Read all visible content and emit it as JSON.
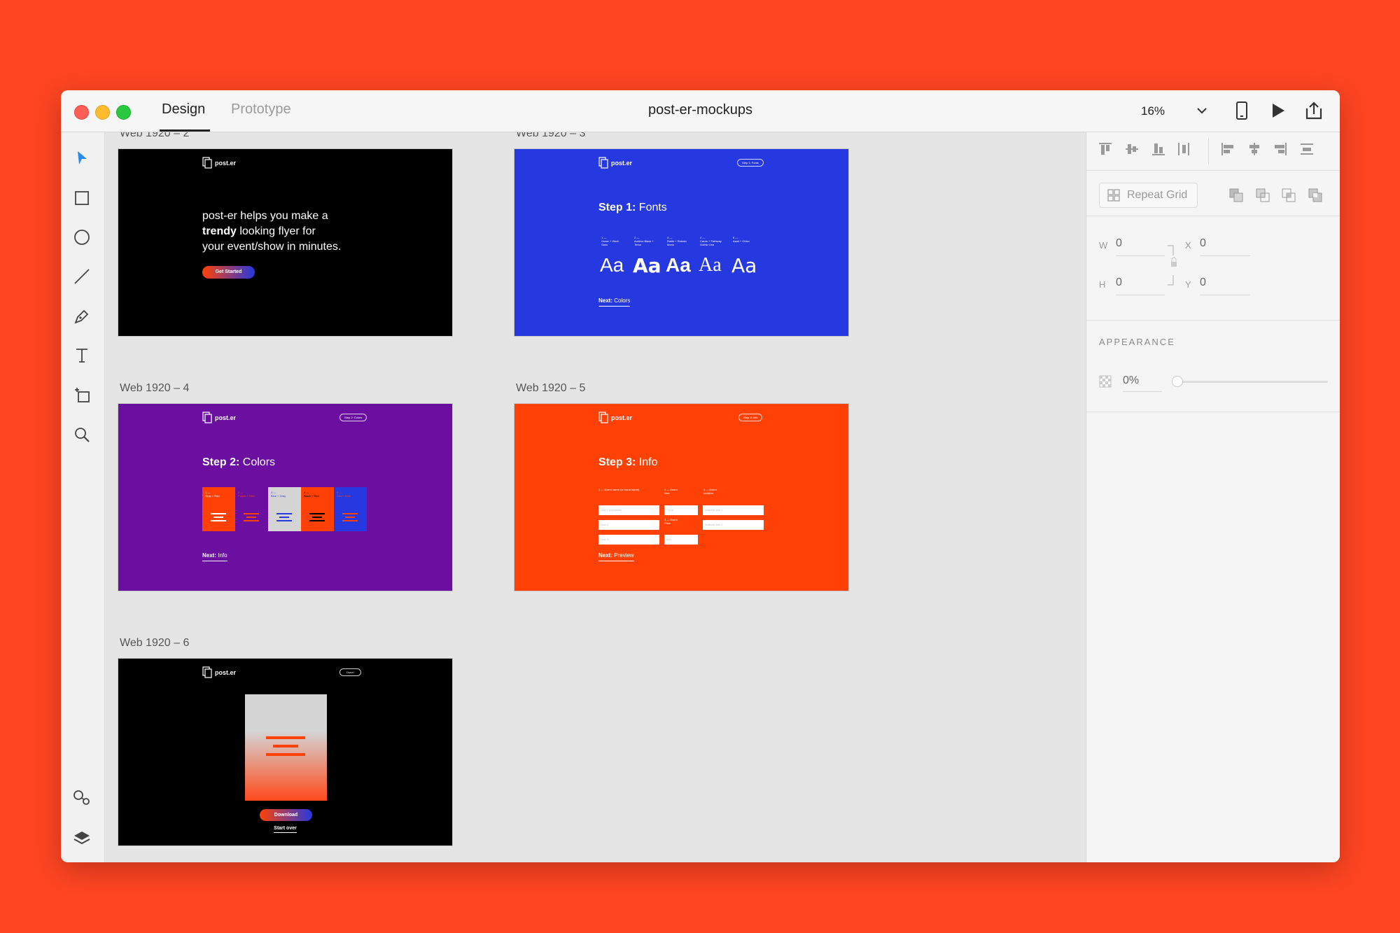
{
  "window": {
    "tabs": [
      "Design",
      "Prototype"
    ],
    "doc_title": "post-er-mockups",
    "zoom": "16%"
  },
  "canvas": {
    "artboards": [
      {
        "label": "Web 1920 – 2",
        "bg": "#000000"
      },
      {
        "label": "Web 1920 – 3",
        "bg": "#2638e0"
      },
      {
        "label": "Web 1920 – 4",
        "bg": "#6a0fa0"
      },
      {
        "label": "Web 1920 – 5",
        "bg": "#ff4106"
      },
      {
        "label": "Web 1920 – 6",
        "bg": "#000000"
      }
    ],
    "logo_text": "post.er",
    "ab2": {
      "line1": "post-er helps you make a",
      "line2_bold": "trendy",
      "line2_rest": " looking flyer for",
      "line3": "your event/show in minutes.",
      "button": "Get Started"
    },
    "ab3": {
      "pill": "Step 1: Fonts",
      "heading_bold": "Step 1:",
      "heading_rest": " Fonts",
      "fonts": [
        {
          "num": "1 —",
          "name": "Gozer + Work Sans"
        },
        {
          "num": "2 —",
          "name": "Archivo Black + Tenor"
        },
        {
          "num": "3 —",
          "name": "Rubik + Roboto Mono"
        },
        {
          "num": "4 —",
          "name": "Cardo + Pathway Gothic One"
        },
        {
          "num": "5 —",
          "name": "Aauil + Chivo"
        }
      ],
      "aa_glyph": "Aa",
      "next_bold": "Next:",
      "next_rest": " Colors"
    },
    "ab4": {
      "pill": "Step 2: Colors",
      "heading_bold": "Step 2:",
      "heading_rest": " Colors",
      "swatches": [
        {
          "num": "1 —",
          "name": "Gray + Red",
          "bg": "#ff4106",
          "text": "#ffffff",
          "line": "#ffffff"
        },
        {
          "num": "2 —",
          "name": "Purple + Red",
          "bg": "#6a0fa0",
          "text": "#ff4106",
          "line": "#ff4106"
        },
        {
          "num": "3 —",
          "name": "Blue + Gray",
          "bg": "#d4d4d4",
          "text": "#2638e0",
          "line": "#2638e0"
        },
        {
          "num": "4 —",
          "name": "Black + Red",
          "bg": "#ff4106",
          "text": "#000000",
          "line": "#000000"
        },
        {
          "num": "5 —",
          "name": "Red + Blue",
          "bg": "#2638e0",
          "text": "#ff4106",
          "line": "#ff4106"
        }
      ],
      "next_bold": "Next:",
      "next_rest": " Info"
    },
    "ab5": {
      "pill": "Step 3: Info",
      "heading_bold": "Step 3:",
      "heading_rest": " Info",
      "col1": "1 — Event name (or band name)",
      "col2": "2 — Event time",
      "col3": "4 — Event location",
      "col4": "3 — Event Price",
      "f1": "Line 1 (Headline)",
      "f2": "Line 2",
      "f3": "Line 3",
      "f4": "7 p.m.",
      "f5": "$10",
      "f6": "Address line 1",
      "f7": "Address line 2",
      "next_bold": "Next:",
      "next_rest": " Preview"
    },
    "ab6": {
      "pill": "Done!",
      "button": "Download",
      "link": "Start over"
    }
  },
  "panel": {
    "repeat_grid": "Repeat Grid",
    "w_label": "W",
    "w_value": "0",
    "h_label": "H",
    "h_value": "0",
    "x_label": "X",
    "x_value": "0",
    "y_label": "Y",
    "y_value": "0",
    "appearance": "APPEARANCE",
    "opacity": "0%"
  },
  "colors": {
    "accent_blue": "#2a8cf0",
    "brand_orange": "#ff4522"
  }
}
